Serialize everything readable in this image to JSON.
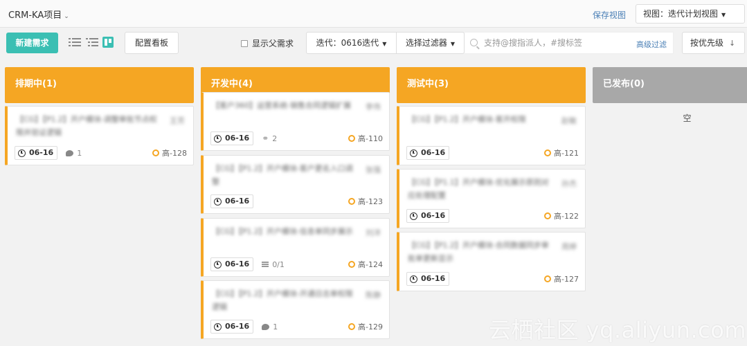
{
  "header": {
    "project": "CRM-KA项目",
    "save_view": "保存视图",
    "view_select": "视图：迭代计划视图"
  },
  "toolbar": {
    "new_label": "新建需求",
    "config_label": "配置看板",
    "show_parent": "显示父需求",
    "iteration": "迭代：0616迭代",
    "filter": "选择过滤器",
    "search_placeholder": "支持@搜指派人，#搜标签",
    "advanced_filter": "高级过滤",
    "sort_label": "按优先级",
    "sort_arrow": "↓"
  },
  "colors": {
    "accent": "#3bbfb3",
    "column_active": "#f5a623",
    "column_done": "#a8a8a8",
    "link": "#4a7fb5"
  },
  "icons": [
    "chevron-down-icon",
    "list-view-icon",
    "tree-view-icon",
    "board-view-icon",
    "search-icon",
    "clock-icon",
    "comment-icon",
    "attachment-icon",
    "checklist-icon",
    "priority-icon"
  ],
  "columns": [
    {
      "title": "排期中(1)",
      "cards": [
        {
          "title": "【CG】【P1.2】开户模块-调整审批节点权限并验证逻辑",
          "assignee": "王芳",
          "date": "06-16",
          "extra_type": "comment",
          "extra": "1",
          "priority": "高-128"
        }
      ]
    },
    {
      "title": "开发中(4)",
      "cards": [
        {
          "title": "【客户360】运营系统-销售合同逻辑扩展",
          "assignee": "李伟",
          "date": "06-16",
          "extra_type": "attachment",
          "extra": "2",
          "priority": "高-110"
        },
        {
          "title": "【CG】【P1.2】开户模块-客户更名入口调整",
          "assignee": "张强",
          "date": "06-16",
          "extra_type": "",
          "extra": "",
          "priority": "高-123"
        },
        {
          "title": "【CG】【P1.2】开户模块-信息单同步展示",
          "assignee": "刘洋",
          "date": "06-16",
          "extra_type": "checklist",
          "extra": "0/1",
          "priority": "高-124"
        },
        {
          "title": "【CG】【P1.2】开户模块-开通日志单权限逻辑",
          "assignee": "陈静",
          "date": "06-16",
          "extra_type": "comment",
          "extra": "1",
          "priority": "高-129"
        }
      ]
    },
    {
      "title": "测试中(3)",
      "cards": [
        {
          "title": "【CG】【P1.2】开户模块-客开权限",
          "assignee": "赵敏",
          "date": "06-16",
          "extra_type": "",
          "extra": "",
          "priority": "高-121"
        },
        {
          "title": "【CG】【P1.1】开户模块-优化展示原则对应处理配置",
          "assignee": "孙杰",
          "date": "06-16",
          "extra_type": "",
          "extra": "",
          "priority": "高-122"
        },
        {
          "title": "【CG】【P1.2】开户模块-合同数据同步审批单更新显示",
          "assignee": "周婷",
          "date": "06-16",
          "extra_type": "",
          "extra": "",
          "priority": "高-127"
        }
      ]
    },
    {
      "title": "已发布(0)",
      "empty": "空",
      "cards": []
    }
  ],
  "watermark": "云栖社区 yq.aliyun.com"
}
